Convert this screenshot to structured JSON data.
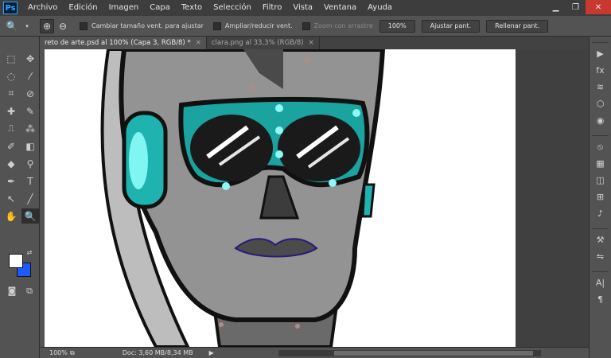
{
  "app": {
    "logo": "Ps"
  },
  "menu": [
    "Archivo",
    "Edición",
    "Imagen",
    "Capa",
    "Texto",
    "Selección",
    "Filtro",
    "Vista",
    "Ventana",
    "Ayuda"
  ],
  "window_controls": {
    "minimize": "▁",
    "restore": "❐",
    "close": "✕"
  },
  "options": {
    "check_resize": "Cambiar tamaño vent. para ajustar",
    "check_zoom_all": "Ampliar/reducir vent.",
    "check_scrubby": "Zoom con arrastre",
    "btn_100": "100%",
    "btn_fit": "Ajustar pant.",
    "btn_fill": "Rellenar pant."
  },
  "tabs": [
    {
      "label": "reto de arte.psd al 100% (Capa 3, RGB/8) *",
      "close": "×"
    },
    {
      "label": "clara.png al 33,3% (RGB/8)",
      "close": "×"
    }
  ],
  "tools": [
    "⬚",
    "✥",
    "◌",
    "⁄",
    "⌗",
    "⊘",
    "✚",
    "✎",
    "⎍",
    "⁂",
    "✐",
    "◧",
    "◆",
    "⚲",
    "✒",
    "T",
    "↖",
    "╱",
    "✋",
    "🔍"
  ],
  "panel_icons": [
    "▶",
    "fx",
    "≋",
    "⬡",
    "◉",
    "⦸",
    "▦",
    "◫",
    "⊞",
    "♪",
    "⚒",
    "⇋",
    "A|",
    "¶"
  ],
  "status": {
    "zoom": "100%",
    "doc": "Doc: 3,60 MB/8,34 MB",
    "arrow": "▶"
  },
  "colors": {
    "foreground": "#ffffff",
    "background": "#1e5bff",
    "accent": "#31a8ff"
  }
}
